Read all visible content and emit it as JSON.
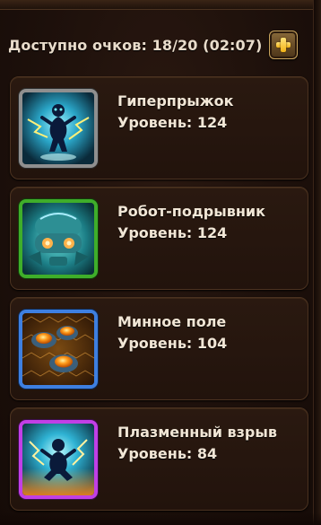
{
  "header": {
    "points_label": "Доступно очков: 18/20 (02:07)",
    "plus_icon": "plus-icon"
  },
  "skills": [
    {
      "name": "Гиперпрыжок",
      "level": "Уровень: 124",
      "frame_color": "#8f8f8f",
      "icon": "hyper-jump-icon"
    },
    {
      "name": "Робот-подрывник",
      "level": "Уровень: 124",
      "frame_color": "#3fae2a",
      "icon": "bomber-robot-icon"
    },
    {
      "name": "Минное поле",
      "level": "Уровень: 104",
      "frame_color": "#3e7fe0",
      "icon": "minefield-icon"
    },
    {
      "name": "Плазменный взрыв",
      "level": "Уровень: 84",
      "frame_color": "#c13fe6",
      "icon": "plasma-blast-icon"
    }
  ]
}
